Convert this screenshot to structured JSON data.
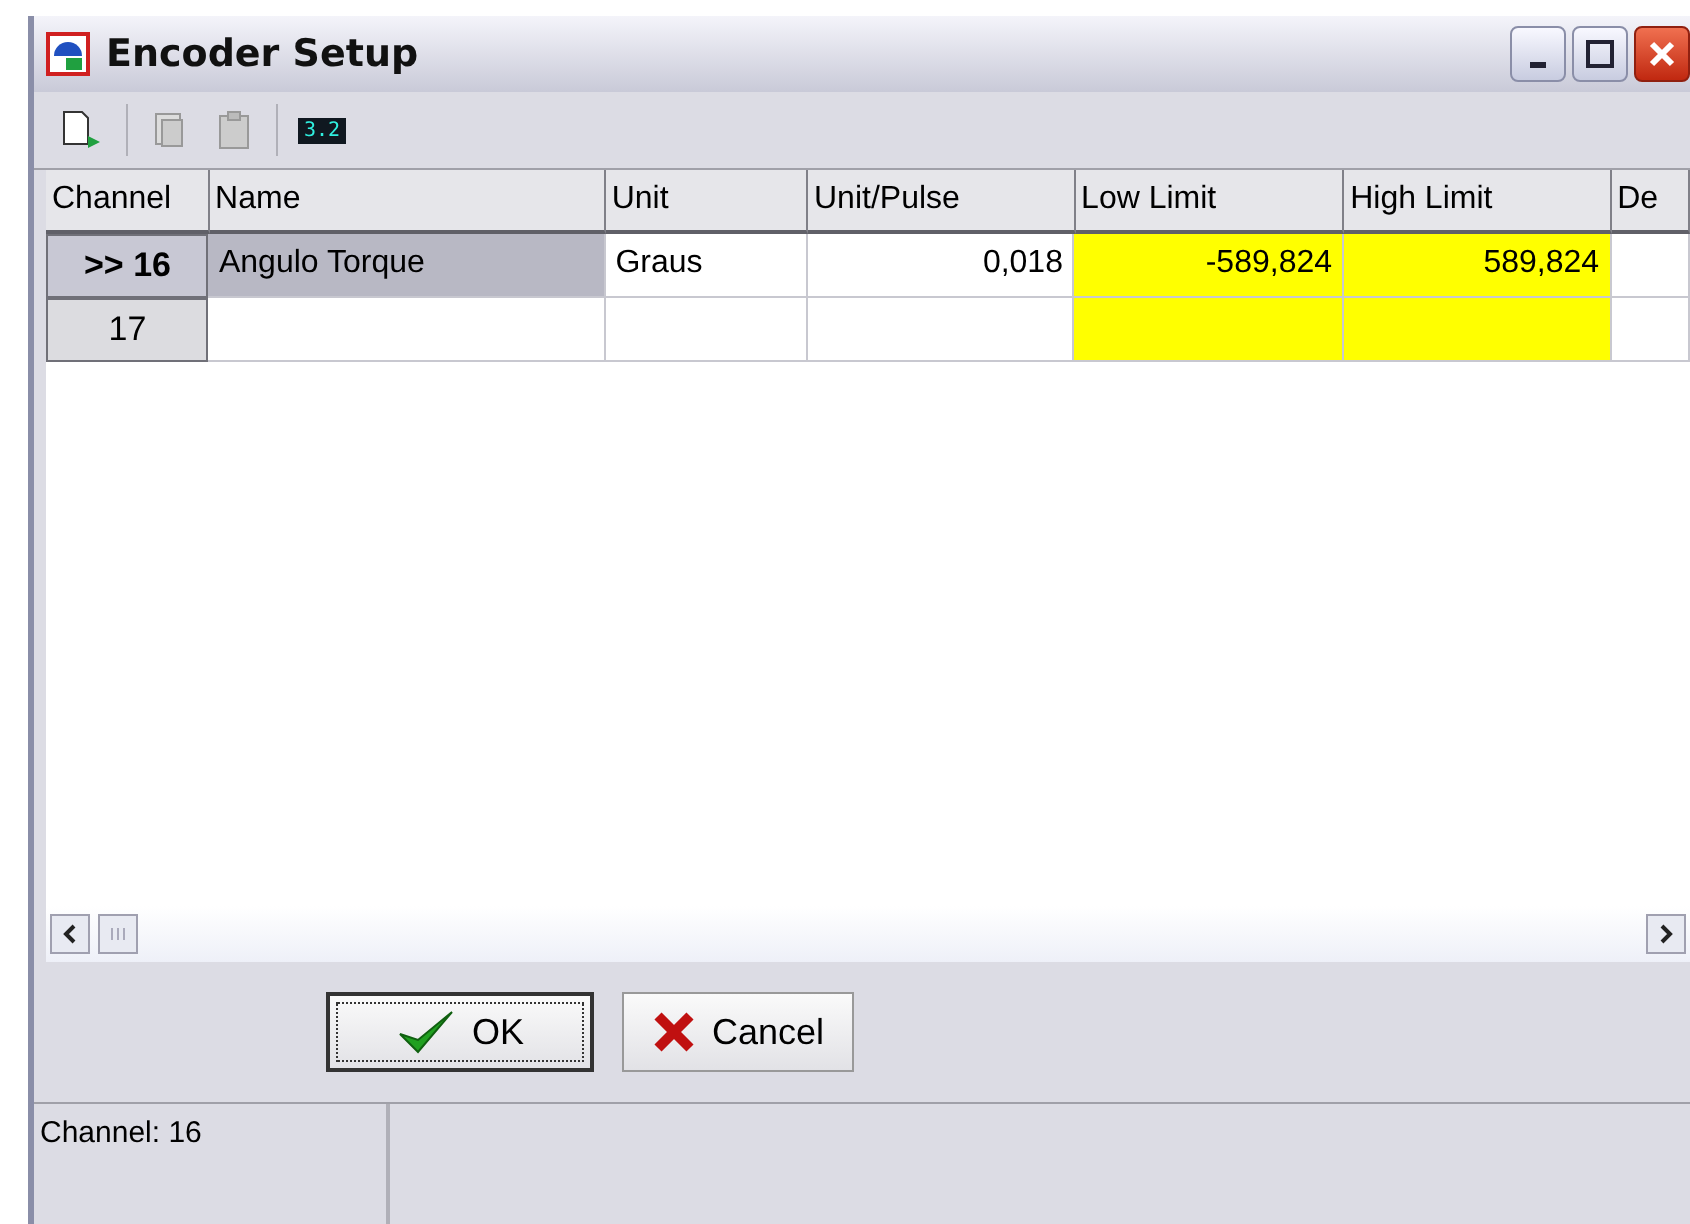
{
  "window": {
    "title": "Encoder Setup"
  },
  "toolbar": {
    "readout": "3.2"
  },
  "table": {
    "columns": [
      {
        "label": "Channel",
        "highlight": false
      },
      {
        "label": "Name",
        "highlight": false
      },
      {
        "label": "Unit",
        "highlight": false
      },
      {
        "label": "Unit/Pulse",
        "highlight": false
      },
      {
        "label": "Low Limit",
        "highlight": true
      },
      {
        "label": "High Limit",
        "highlight": true
      },
      {
        "label": "De",
        "highlight": false
      }
    ],
    "rows": [
      {
        "selected": true,
        "cells": [
          ">> 16",
          "Angulo Torque",
          "Graus",
          "0,018",
          "-589,824",
          "589,824",
          ""
        ]
      },
      {
        "selected": false,
        "cells": [
          "17",
          "",
          "",
          "",
          "",
          "",
          ""
        ]
      }
    ]
  },
  "buttons": [
    {
      "kind": "ok",
      "label": "OK",
      "focused": true
    },
    {
      "kind": "cancel",
      "label": "Cancel",
      "focused": false
    }
  ],
  "status_bar": {
    "text": "Channel: 16"
  }
}
